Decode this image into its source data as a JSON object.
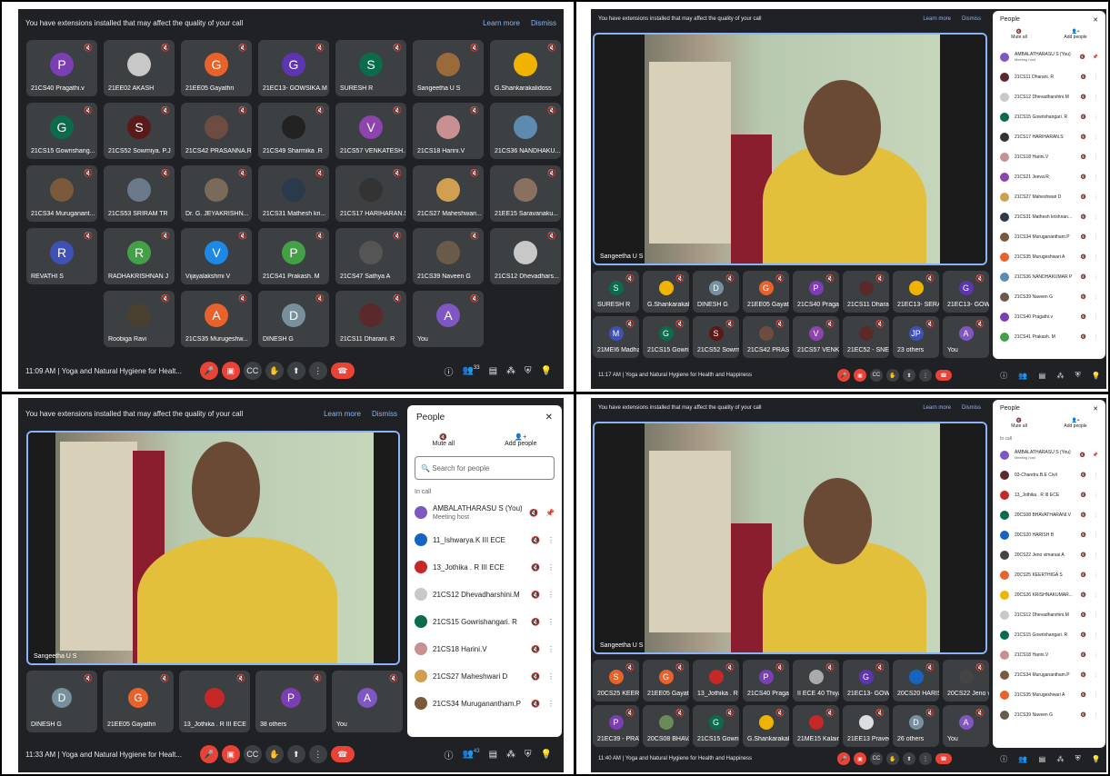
{
  "banner": {
    "message": "You have extensions installed that may affect the quality of your call",
    "learn_more": "Learn more",
    "dismiss": "Dismiss"
  },
  "q1": {
    "tiles": [
      {
        "name": "21CS40 Pragathi.v",
        "initial": "P",
        "color": "#7b3fb3"
      },
      {
        "name": "21EE02 AKASH",
        "initial": "",
        "color": "#c8c8c8"
      },
      {
        "name": "21EE05 Gayathri",
        "initial": "G",
        "color": "#e8622c"
      },
      {
        "name": "21EC13- GOWSIKA.M",
        "initial": "G",
        "color": "#5e35b1"
      },
      {
        "name": "SURESH R",
        "initial": "S",
        "color": "#0b6b4a"
      },
      {
        "name": "Sangeetha U S",
        "initial": "",
        "color": "#9b6a3a"
      },
      {
        "name": "G.Shankarakalidoss",
        "initial": "",
        "color": "#f0b400"
      },
      {
        "name": "21CS15 Gowrishang...",
        "initial": "G",
        "color": "#0b6b4a"
      },
      {
        "name": "21CS52 Sowmiya. P.J",
        "initial": "S",
        "color": "#5a1a1a"
      },
      {
        "name": "21CS42 PRASANNA.R",
        "initial": "",
        "color": "#6d4c41"
      },
      {
        "name": "21CS49 Sharmika .R",
        "initial": "",
        "color": "#222"
      },
      {
        "name": "21CS57 VENKATESH...",
        "initial": "V",
        "color": "#8e44ad"
      },
      {
        "name": "21CS18 Harini.V",
        "initial": "",
        "color": "#c89090"
      },
      {
        "name": "21CS36 NANDHAKU...",
        "initial": "",
        "color": "#5c8ab0"
      },
      {
        "name": "21CS34 Muruganant...",
        "initial": "",
        "color": "#7a5a3a"
      },
      {
        "name": "21CS53 SRIRAM TR",
        "initial": "",
        "color": "#6a7a8a"
      },
      {
        "name": "Dr. G. JEYAKRISHN...",
        "initial": "",
        "color": "#7a6a5a"
      },
      {
        "name": "21CS31 Mathesh kri...",
        "initial": "",
        "color": "#2a3a4a"
      },
      {
        "name": "21CS17 HARIHARAN.S",
        "initial": "",
        "color": "#333"
      },
      {
        "name": "21CS27 Maheshwari...",
        "initial": "",
        "color": "#d0a050"
      },
      {
        "name": "21EE15 Saravanaku...",
        "initial": "",
        "color": "#8a7060"
      },
      {
        "name": "REVATHI S",
        "initial": "R",
        "color": "#3f51b5"
      },
      {
        "name": "RADHAKRISHNAN J",
        "initial": "R",
        "color": "#43a047"
      },
      {
        "name": "Vijayalakshmi V",
        "initial": "V",
        "color": "#1e88e5"
      },
      {
        "name": "21CS41 Prakash. M",
        "initial": "P",
        "color": "#43a047"
      },
      {
        "name": "21CS47 Sathya A",
        "initial": "",
        "color": "#555"
      },
      {
        "name": "21CS39 Naveen G",
        "initial": "",
        "color": "#6a5a4a"
      },
      {
        "name": "21CS12 Dhevadhars...",
        "initial": "",
        "color": "#c8c8c8"
      },
      {
        "name": "Roobiga Ravi",
        "initial": "",
        "color": "#4a4030"
      },
      {
        "name": "21CS35 Murugeshw...",
        "initial": "A",
        "color": "#e8622c"
      },
      {
        "name": "DINESH G",
        "initial": "D",
        "color": "#78909c"
      },
      {
        "name": "21CS11 Dharani. R",
        "initial": "",
        "color": "#5a2a2a"
      },
      {
        "name": "You",
        "initial": "A",
        "color": "#7e57c2"
      }
    ],
    "time": "11:09 AM",
    "meeting": "Yoga and Natural Hygiene for Healt...",
    "count": "33"
  },
  "q2": {
    "speaker": "Sangeetha U S",
    "people_title": "People",
    "mute_all": "Mute all",
    "add_people": "Add people",
    "people": [
      {
        "name": "AMBALATHARASU S (You)",
        "sub": "Meeting host",
        "color": "#7e57c2"
      },
      {
        "name": "21CS11 Dharani. R",
        "sub": "",
        "color": "#5a2a2a"
      },
      {
        "name": "21CS12 Dhevadharshini.M",
        "sub": "",
        "color": "#c8c8c8"
      },
      {
        "name": "21CS15 Gowrishangari. R",
        "sub": "",
        "color": "#0b6b4a"
      },
      {
        "name": "21CS17 HARIHARAN.S",
        "sub": "",
        "color": "#333"
      },
      {
        "name": "21CS18 Harini.V",
        "sub": "",
        "color": "#c89090"
      },
      {
        "name": "21CS21 Jeeva.R",
        "sub": "",
        "color": "#8e44ad"
      },
      {
        "name": "21CS27 Maheshwari D",
        "sub": "",
        "color": "#d0a050"
      },
      {
        "name": "21CS31 Mathesh krishnan...",
        "sub": "",
        "color": "#2a3a4a"
      },
      {
        "name": "21CS34 Muruganantham.P",
        "sub": "",
        "color": "#7a5a3a"
      },
      {
        "name": "21CS35 Murugeshwari A",
        "sub": "",
        "color": "#e8622c"
      },
      {
        "name": "21CS36 NANDHAKUMAR P",
        "sub": "",
        "color": "#5c8ab0"
      },
      {
        "name": "21CS39 Naveen G",
        "sub": "",
        "color": "#6a5a4a"
      },
      {
        "name": "21CS40 Pragathi.v",
        "sub": "",
        "color": "#7b3fb3"
      },
      {
        "name": "21CS41 Prakash. M",
        "sub": "",
        "color": "#43a047"
      }
    ],
    "strip": [
      {
        "name": "SURESH R",
        "initial": "S",
        "color": "#0b6b4a"
      },
      {
        "name": "G.Shankarakalido...",
        "initial": "",
        "color": "#f0b400"
      },
      {
        "name": "DINESH G",
        "initial": "D",
        "color": "#78909c"
      },
      {
        "name": "21EE05 Gayathri",
        "initial": "G",
        "color": "#e8622c"
      },
      {
        "name": "21CS40 Pragathi.v",
        "initial": "P",
        "color": "#7b3fb3"
      },
      {
        "name": "21CS11 Dharani. R",
        "initial": "",
        "color": "#5a2a2a"
      },
      {
        "name": "21EC13- SERAN B",
        "initial": "",
        "color": "#f0b400"
      },
      {
        "name": "21EC13- GOWSIK...",
        "initial": "G",
        "color": "#5e35b1"
      },
      {
        "name": "21MEI6 Madhan R",
        "initial": "M",
        "color": "#3f51b5"
      },
      {
        "name": "21CS15 Gowrisha...",
        "initial": "G",
        "color": "#0b6b4a"
      },
      {
        "name": "21CS52 Sowmiya...",
        "initial": "S",
        "color": "#5a1a1a"
      },
      {
        "name": "21CS42 PRASAN...",
        "initial": "",
        "color": "#6d4c41"
      },
      {
        "name": "21CS57 VENKATE...",
        "initial": "V",
        "color": "#8e44ad"
      },
      {
        "name": "21EC52 - SNEHAR...",
        "initial": "",
        "color": "#5a2a2a"
      },
      {
        "name": "23 others",
        "initial": "JP",
        "color": "#3f51b5"
      },
      {
        "name": "You",
        "initial": "A",
        "color": "#7e57c2"
      }
    ],
    "time": "11:17 AM",
    "meeting": "Yoga and Natural Hygiene for Health and Happiness"
  },
  "q3": {
    "speaker": "Sangeetha U S",
    "people_title": "People",
    "mute_all": "Mute all",
    "add_people": "Add people",
    "search_placeholder": "Search for people",
    "in_call": "In call",
    "people": [
      {
        "name": "AMBALATHARASU S (You)",
        "sub": "Meeting host",
        "color": "#7e57c2"
      },
      {
        "name": "11_Ishwarya.K III ECE",
        "sub": "",
        "color": "#1565c0"
      },
      {
        "name": "13_Jothika . R III ECE",
        "sub": "",
        "color": "#c62828"
      },
      {
        "name": "21CS12 Dhevadharshini.M",
        "sub": "",
        "color": "#c8c8c8"
      },
      {
        "name": "21CS15 Gowrishangari. R",
        "sub": "",
        "color": "#0b6b4a"
      },
      {
        "name": "21CS18 Harini.V",
        "sub": "",
        "color": "#c89090"
      },
      {
        "name": "21CS27 Maheshwari D",
        "sub": "",
        "color": "#d0a050"
      },
      {
        "name": "21CS34 Muruganantham.P",
        "sub": "",
        "color": "#7a5a3a"
      }
    ],
    "strip": [
      {
        "name": "DINESH G",
        "initial": "D",
        "color": "#78909c"
      },
      {
        "name": "21EE05 Gayathri",
        "initial": "G",
        "color": "#e8622c"
      },
      {
        "name": "13_Jothika . R III ECE",
        "initial": "",
        "color": "#c62828"
      },
      {
        "name": "38 others",
        "initial": "P",
        "color": "#7b3fb3"
      },
      {
        "name": "You",
        "initial": "A",
        "color": "#7e57c2"
      }
    ],
    "time": "11:33 AM",
    "meeting": "Yoga and Natural Hygiene for Healt...",
    "count": "43"
  },
  "q4": {
    "speaker": "Sangeetha U S",
    "people_title": "People",
    "mute_all": "Mute all",
    "add_people": "Add people",
    "in_call": "In call",
    "people": [
      {
        "name": "AMBALATHARASU S (You)",
        "sub": "Meeting host",
        "color": "#7e57c2"
      },
      {
        "name": "03-Chandru.B.E Civil",
        "sub": "",
        "color": "#5a2a2a"
      },
      {
        "name": "13_Jothika . R III ECE",
        "sub": "",
        "color": "#c62828"
      },
      {
        "name": "20CS08 BHAVATHARANI.V",
        "sub": "",
        "color": "#0b6b4a"
      },
      {
        "name": "20CS20 HARISH B",
        "sub": "",
        "color": "#1565c0"
      },
      {
        "name": "20CS22 Jeno vimarasi A",
        "sub": "",
        "color": "#444"
      },
      {
        "name": "20CS25 KEERTHIGA S",
        "sub": "",
        "color": "#e8622c"
      },
      {
        "name": "20CS26 KRISHNAKUMAR...",
        "sub": "",
        "color": "#f0b400"
      },
      {
        "name": "21CS12 Dhevadharshini.M",
        "sub": "",
        "color": "#c8c8c8"
      },
      {
        "name": "21CS15 Gowrishangari. R",
        "sub": "",
        "color": "#0b6b4a"
      },
      {
        "name": "21CS18 Harini.V",
        "sub": "",
        "color": "#c89090"
      },
      {
        "name": "21CS34 Muruganantham.P",
        "sub": "",
        "color": "#7a5a3a"
      },
      {
        "name": "21CS35 Murugeshwari A",
        "sub": "",
        "color": "#e8622c"
      },
      {
        "name": "21CS39 Naveen G",
        "sub": "",
        "color": "#6a5a4a"
      }
    ],
    "strip": [
      {
        "name": "20CS25 KEERTH...",
        "initial": "S",
        "color": "#e8622c"
      },
      {
        "name": "21EE05 Gayathri",
        "initial": "G",
        "color": "#e8622c"
      },
      {
        "name": "13_Jothika . R III E...",
        "initial": "",
        "color": "#c62828"
      },
      {
        "name": "21CS40 Pragathi.v",
        "initial": "P",
        "color": "#7b3fb3"
      },
      {
        "name": "II ECE 40 Thiyahal...",
        "initial": "",
        "color": "#aaa"
      },
      {
        "name": "21EC13- GOWSIK...",
        "initial": "G",
        "color": "#5e35b1"
      },
      {
        "name": "20CS20 HARISH B",
        "initial": "",
        "color": "#1565c0"
      },
      {
        "name": "20CS22 Jeno vin...",
        "initial": "",
        "color": "#444"
      },
      {
        "name": "21EC39 - PRAVEE...",
        "initial": "P",
        "color": "#7b3fb3"
      },
      {
        "name": "20CS08 BHAVAT...",
        "initial": "",
        "color": "#6a8a5a"
      },
      {
        "name": "21CS15 Gowrisha...",
        "initial": "G",
        "color": "#0b6b4a"
      },
      {
        "name": "G.Shankarakalido...",
        "initial": "",
        "color": "#f0b400"
      },
      {
        "name": "21ME15 Kalaimar...",
        "initial": "",
        "color": "#c62828"
      },
      {
        "name": "21EE13 Praveen",
        "initial": "",
        "color": "#ddd"
      },
      {
        "name": "26 others",
        "initial": "D",
        "color": "#78909c"
      },
      {
        "name": "You",
        "initial": "A",
        "color": "#7e57c2"
      }
    ],
    "time": "11:40 AM",
    "meeting": "Yoga and Natural Hygiene for Health and Happiness"
  }
}
